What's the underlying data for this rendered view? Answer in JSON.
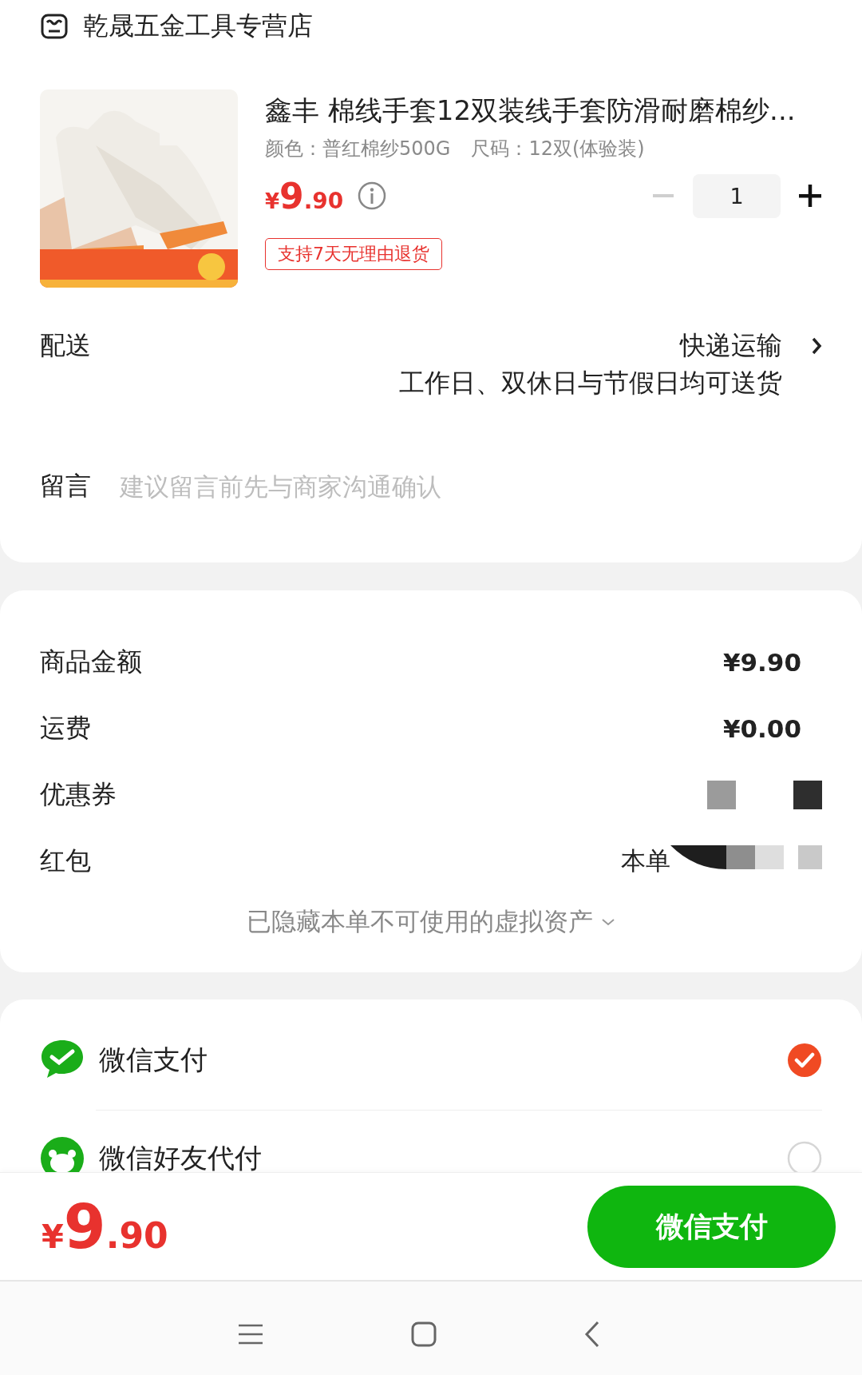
{
  "store": {
    "name": "乾晟五金工具专营店"
  },
  "product": {
    "title": "鑫丰 棉线手套12双装线手套防滑耐磨棉纱...",
    "color_spec": "颜色：普红棉纱500G",
    "size_spec": "尺码：12双(体验装)",
    "price": {
      "currency": "¥",
      "integer": "9",
      "decimal": ".90"
    },
    "quantity": "1",
    "minus_disabled": true,
    "tag": "支持7天无理由退货"
  },
  "delivery": {
    "label": "配送",
    "method": "快递运输",
    "note": "工作日、双休日与节假日均可送货"
  },
  "message": {
    "label": "留言",
    "placeholder": "建议留言前先与商家沟通确认"
  },
  "summary": {
    "rows": [
      {
        "kind": "amount",
        "label": "商品金额",
        "value": "¥9.90"
      },
      {
        "kind": "amount",
        "label": "运费",
        "value": "¥0.00"
      },
      {
        "kind": "redacted",
        "label": "优惠券"
      },
      {
        "kind": "redacted",
        "label": "红包",
        "value": "本单"
      }
    ],
    "hidden_note": "已隐藏本单不可使用的虚拟资产"
  },
  "payment": {
    "methods": [
      {
        "kind": "wechat",
        "name": "微信支付",
        "selected": true
      },
      {
        "kind": "friend",
        "name": "微信好友代付",
        "selected": false
      }
    ]
  },
  "footer": {
    "total": {
      "currency": "¥",
      "integer": "9",
      "decimal": ".90"
    },
    "pay_button": "微信支付"
  }
}
